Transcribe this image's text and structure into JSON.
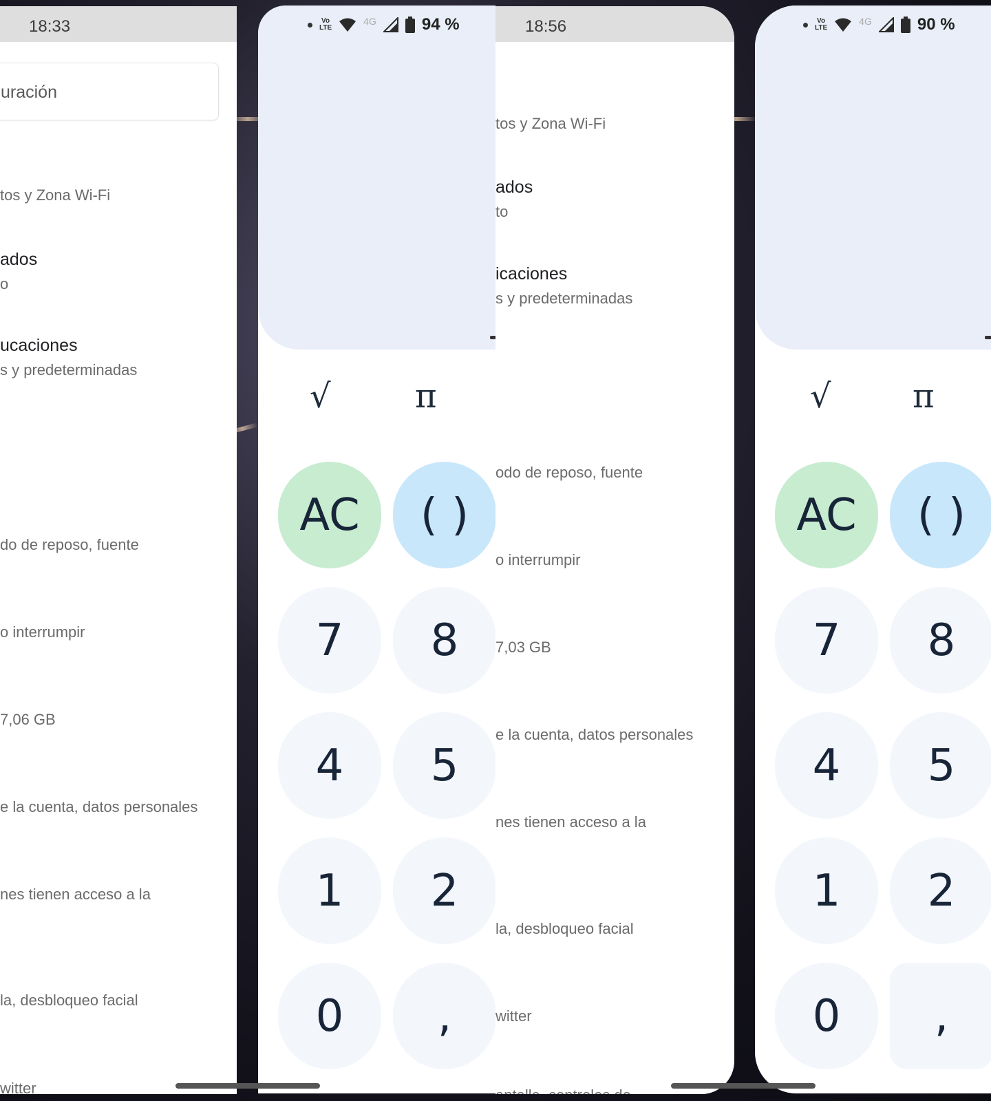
{
  "settings_panel_1": {
    "time": "18:33",
    "search_text": "uración",
    "rows": [
      {
        "title": "",
        "sub": "tos y Zona Wi-Fi"
      },
      {
        "title": "ados",
        "sub": "o"
      },
      {
        "title": "ucaciones",
        "sub": "s y predeterminadas"
      },
      {
        "title": "",
        "sub": "do de reposo, fuente"
      },
      {
        "title": "",
        "sub": "o interrumpir"
      },
      {
        "title": "",
        "sub": "7,06 GB"
      },
      {
        "title": "",
        "sub": "e la cuenta, datos personales"
      },
      {
        "title": "",
        "sub": "nes tienen acceso a la"
      },
      {
        "title": "",
        "sub": "la, desbloqueo facial"
      },
      {
        "title": "",
        "sub": "witter"
      }
    ]
  },
  "calc_panel_1": {
    "status": {
      "dot": "•",
      "volte_top": "Vo",
      "volte_bottom": "LTE",
      "net": "4G",
      "battery": "94 %"
    },
    "sqrt": "√",
    "pi": "π",
    "keys": {
      "ac": "AC",
      "paren": "( )",
      "seven": "7",
      "eight": "8",
      "four": "4",
      "five": "5",
      "one": "1",
      "two": "2",
      "zero": "0",
      "comma": ","
    }
  },
  "settings_panel_2": {
    "time": "18:56",
    "rows": [
      {
        "title": "",
        "sub": "tos y Zona Wi-Fi"
      },
      {
        "title": "ados",
        "sub": "to"
      },
      {
        "title": "icaciones",
        "sub": "s y predeterminadas"
      },
      {
        "title": "",
        "sub": "odo de reposo, fuente"
      },
      {
        "title": "",
        "sub": "o interrumpir"
      },
      {
        "title": "",
        "sub": "7,03 GB"
      },
      {
        "title": "",
        "sub": "e la cuenta, datos personales"
      },
      {
        "title": "",
        "sub": "nes tienen acceso a la"
      },
      {
        "title": "",
        "sub": "la, desbloqueo facial"
      },
      {
        "title": "",
        "sub": "witter"
      },
      {
        "title": "",
        "sub": "antalla, controles de"
      }
    ]
  },
  "calc_panel_2": {
    "status": {
      "dot": "•",
      "volte_top": "Vo",
      "volte_bottom": "LTE",
      "net": "4G",
      "battery": "90 %"
    },
    "sqrt": "√",
    "pi": "π",
    "keys": {
      "ac": "AC",
      "paren": "( )",
      "seven": "7",
      "eight": "8",
      "four": "4",
      "five": "5",
      "one": "1",
      "two": "2",
      "zero": "0",
      "comma": ","
    }
  },
  "colors": {
    "ac_key": "#c7ecd0",
    "paren_key": "#c8e7fb",
    "digit_key": "#f3f6fb",
    "display": "#e9eef8"
  },
  "icons": [
    "wifi-icon",
    "signal-icon",
    "battery-icon",
    "volte-icon"
  ]
}
